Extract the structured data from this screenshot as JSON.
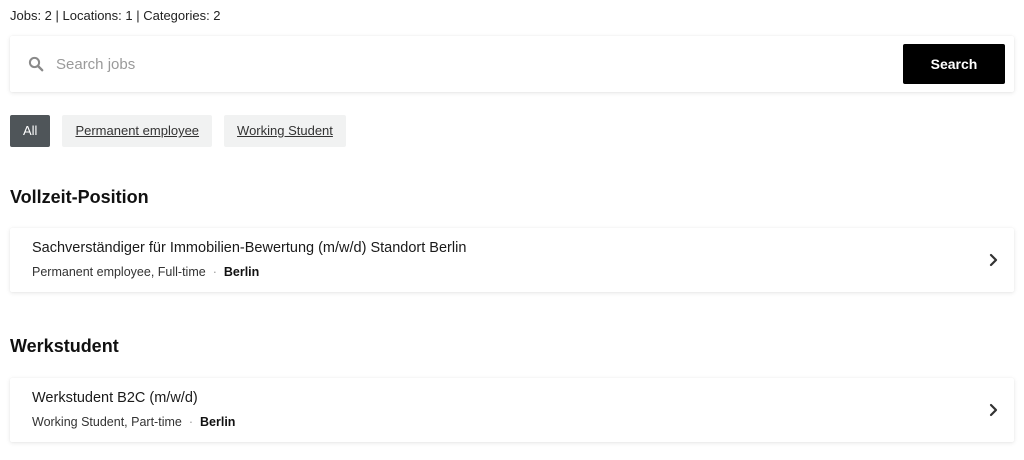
{
  "stats": {
    "text": "Jobs: 2 | Locations: 1 | Categories: 2"
  },
  "search": {
    "placeholder": "Search jobs",
    "value": "",
    "button_label": "Search",
    "icon": "search-icon"
  },
  "filters": {
    "all": "All",
    "permanent": "Permanent employee",
    "working_student": "Working Student",
    "selected": "All"
  },
  "sections": [
    {
      "title": "Vollzeit-Position",
      "jobs": [
        {
          "title": "Sachverständiger für Immobilien-Bewertung (m/w/d) Standort Berlin",
          "type": "Permanent employee, Full-time",
          "separator": "·",
          "location": "Berlin"
        }
      ]
    },
    {
      "title": "Werkstudent",
      "jobs": [
        {
          "title": "Werkstudent B2C (m/w/d)",
          "type": "Working Student, Part-time",
          "separator": "·",
          "location": "Berlin"
        }
      ]
    }
  ],
  "colors": {
    "search_button_bg": "#000000",
    "active_chip_bg": "#4f5559",
    "chip_bg": "#f1f2f2"
  }
}
